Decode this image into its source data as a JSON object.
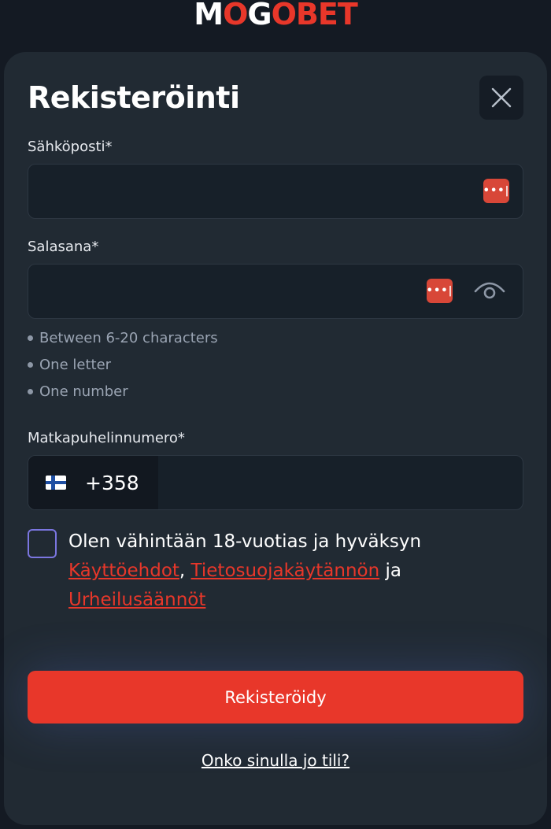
{
  "brand": {
    "logo_part1": "M",
    "logo_part2": "O",
    "logo_part3": "G",
    "logo_part4": "O",
    "logo_part5": "BET"
  },
  "modal": {
    "title": "Rekisteröinti"
  },
  "email": {
    "label": "Sähköposti*",
    "value": "",
    "password_manager_icon": "password-manager-icon"
  },
  "password": {
    "label": "Salasana*",
    "value": "",
    "rules": [
      "Between 6-20 characters",
      "One letter",
      "One number"
    ]
  },
  "phone": {
    "label": "Matkapuhelinnumero*",
    "country_code": "+358",
    "value": ""
  },
  "terms": {
    "text_before": "Olen vähintään 18-vuotias ja hyväksyn ",
    "link1": "Käyttöehdot",
    "sep1": ", ",
    "link2": "Tietosuojakäytännön",
    "sep2": " ja ",
    "link3": "Urheilusäännöt",
    "checked": false
  },
  "actions": {
    "submit_label": "Rekisteröidy",
    "login_link": "Onko sinulla jo tili?"
  },
  "colors": {
    "accent": "#e8372a",
    "background": "#141a23",
    "panel": "#212a33",
    "checkbox_border": "#7b76e0"
  }
}
